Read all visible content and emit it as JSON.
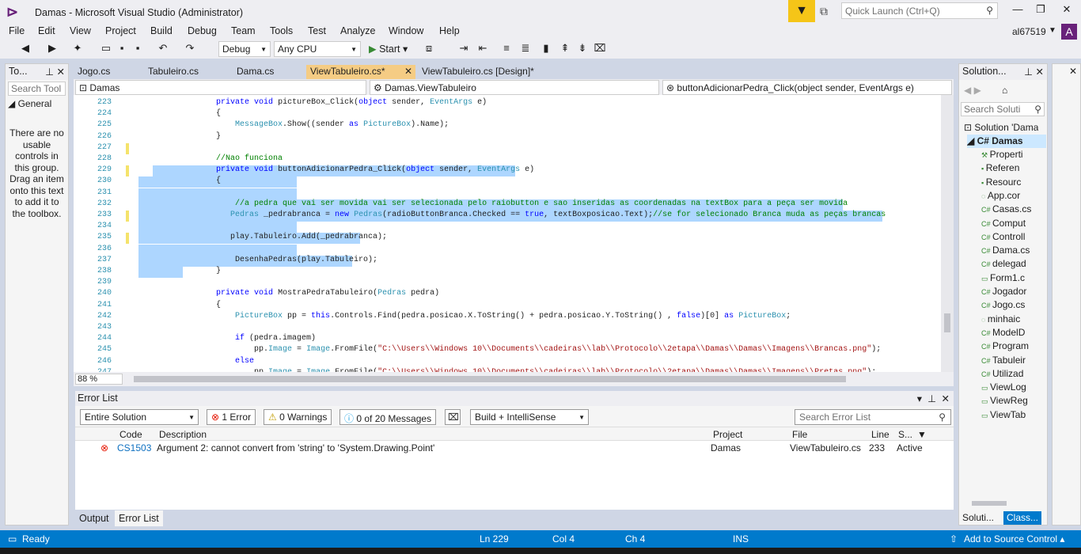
{
  "app": {
    "title": "Damas - Microsoft Visual Studio  (Administrator)",
    "quick_launch": "Quick Launch (Ctrl+Q)",
    "user": "al67519",
    "avatar": "A"
  },
  "menu": [
    "File",
    "Edit",
    "View",
    "Project",
    "Build",
    "Debug",
    "Team",
    "Tools",
    "Test",
    "Analyze",
    "Window",
    "Help"
  ],
  "toolbar": {
    "config": "Debug",
    "platform": "Any CPU",
    "start": "Start"
  },
  "toolbox": {
    "title": "To...",
    "search": "Search Tool",
    "group": "General",
    "empty": "There are no usable controls in this group. Drag an item onto this text to add it to the toolbox."
  },
  "tabs": [
    "Jogo.cs",
    "Tabuleiro.cs",
    "Dama.cs",
    "ViewTabuleiro.cs*",
    "ViewTabuleiro.cs [Design]*"
  ],
  "nav": {
    "project": "Damas",
    "class": "Damas.ViewTabuleiro",
    "member": "buttonAdicionarPedra_Click(object sender, EventArgs e)"
  },
  "code_lines": [
    {
      "n": "223",
      "t": "        private void pictureBox_Click(object sender, EventArgs e)"
    },
    {
      "n": "224",
      "t": "        {"
    },
    {
      "n": "225",
      "t": "            MessageBox.Show((sender as PictureBox).Name);"
    },
    {
      "n": "226",
      "t": "        }"
    },
    {
      "n": "227",
      "t": ""
    },
    {
      "n": "228",
      "t": "        //Nao funciona"
    },
    {
      "n": "229",
      "t": "        private void buttonAdicionarPedra_Click(object sender, EventArgs e)"
    },
    {
      "n": "230",
      "t": "        {"
    },
    {
      "n": "231",
      "t": ""
    },
    {
      "n": "232",
      "t": "            //a pedra que vai ser movida vai ser selecionada pelo raiobutton e sao inseridas as coordenadas na textBox para a peça ser movida"
    },
    {
      "n": "233",
      "t": "           Pedras _pedrabranca = new Pedras(radioButtonBranca.Checked == true, textBoxposicao.Text);//se for selecionado Branca muda as peças brancas"
    },
    {
      "n": "234",
      "t": ""
    },
    {
      "n": "235",
      "t": "           play.Tabuleiro.Add(_pedrabranca);"
    },
    {
      "n": "236",
      "t": ""
    },
    {
      "n": "237",
      "t": "            DesenhaPedras(play.Tabuleiro);"
    },
    {
      "n": "238",
      "t": "        }"
    },
    {
      "n": "239",
      "t": ""
    },
    {
      "n": "240",
      "t": "        private void MostraPedraTabuleiro(Pedras pedra)"
    },
    {
      "n": "241",
      "t": "        {"
    },
    {
      "n": "242",
      "t": "            PictureBox pp = this.Controls.Find(pedra.posicao.X.ToString() + pedra.posicao.Y.ToString() , false)[0] as PictureBox;"
    },
    {
      "n": "243",
      "t": ""
    },
    {
      "n": "244",
      "t": "            if (pedra.imagem)"
    },
    {
      "n": "245",
      "t": "                pp.Image = Image.FromFile(\"C:\\\\Users\\\\Windows 10\\\\Documents\\\\cadeiras\\\\lab\\\\Protocolo\\\\2etapa\\\\Damas\\\\Damas\\\\Imagens\\\\Brancas.png\");"
    },
    {
      "n": "246",
      "t": "            else"
    },
    {
      "n": "247",
      "t": "                pp.Image = Image.FromFile(\"C:\\\\Users\\\\Windows 10\\\\Documents\\\\cadeiras\\\\lab\\\\Protocolo\\\\2etapa\\\\Damas\\\\Damas\\\\Imagens\\\\Pretas.png\");"
    }
  ],
  "zoom": "88 %",
  "error_list": {
    "title": "Error List",
    "scope": "Entire Solution",
    "errors": "1 Error",
    "warnings": "0 Warnings",
    "messages": "0 of 20 Messages",
    "build": "Build + IntelliSense",
    "search": "Search Error List",
    "columns": [
      "Code",
      "Description",
      "Project",
      "File",
      "Line",
      "S..."
    ],
    "row": {
      "code": "CS1503",
      "desc": "Argument 2: cannot convert from 'string' to 'System.Drawing.Point'",
      "project": "Damas",
      "file": "ViewTabuleiro.cs",
      "line": "233",
      "status": "Active"
    }
  },
  "bottom_tabs": [
    "Output",
    "Error List"
  ],
  "solution": {
    "title": "Solution...",
    "search": "Search Soluti",
    "root": "Solution 'Dama",
    "project": "Damas",
    "items": [
      "Properti",
      "Referen",
      "Resourc",
      "App.cor",
      "Casas.cs",
      "Comput",
      "Controll",
      "Dama.cs",
      "delegad",
      "Form1.c",
      "Jogador",
      "Jogo.cs",
      "minhaic",
      "ModelD",
      "Program",
      "Tabuleir",
      "Utilizad",
      "ViewLog",
      "ViewReg",
      "ViewTab"
    ],
    "tabs": [
      "Soluti...",
      "Class..."
    ]
  },
  "status": {
    "ready": "Ready",
    "ln": "Ln 229",
    "col": "Col 4",
    "ch": "Ch 4",
    "ins": "INS",
    "scc": "Add to Source Control"
  },
  "colors": {
    "accent": "#007acc",
    "tab_active": "#f5cc84",
    "selection": "#add6ff",
    "brand": "#68217a"
  }
}
